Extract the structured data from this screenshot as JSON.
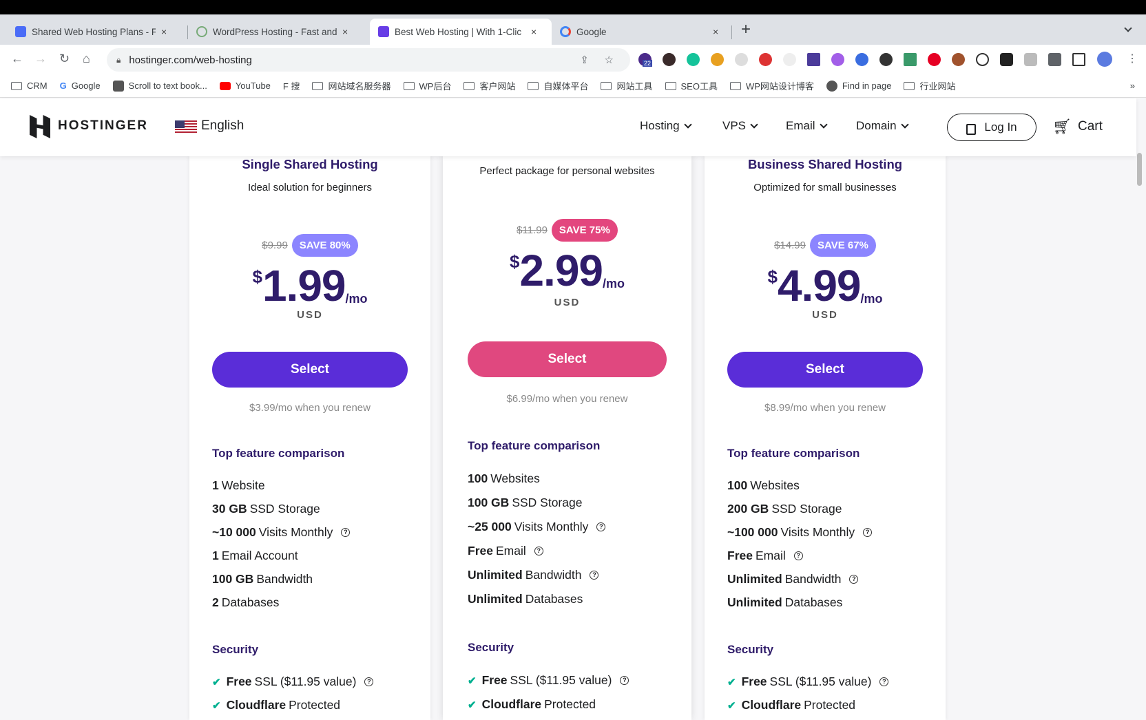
{
  "browser": {
    "tabs": [
      {
        "title": "Shared Web Hosting Plans - Fa",
        "icon": "grid-icon"
      },
      {
        "title": "WordPress Hosting - Fast and",
        "icon": "wp-icon"
      },
      {
        "title": "Best Web Hosting | With 1-Clic",
        "icon": "hostinger-icon",
        "active": true
      },
      {
        "title": "Google",
        "icon": "google-icon"
      }
    ],
    "close": "×",
    "new_tab": "+",
    "url": "hostinger.com/web-hosting",
    "ext_badge": "22",
    "bookmarks": [
      "CRM",
      "Google",
      "Scroll to text book...",
      "YouTube",
      "F 搜",
      "网站域名服务器",
      "WP后台",
      "客户网站",
      "自媒体平台",
      "网站工具",
      "SEO工具",
      "WP网站设计博客",
      "Find in page",
      "行业网站"
    ],
    "more": "»"
  },
  "header": {
    "logo": "HOSTINGER",
    "language": "English",
    "menu": [
      "Hosting",
      "VPS",
      "Email",
      "Domain"
    ],
    "login": "Log In",
    "cart": "Cart"
  },
  "colors": {
    "brand": "#673de6",
    "pink": "#e3467e",
    "badge_purple": "#8c85ff",
    "text": "#2f1c6a"
  },
  "plans": [
    {
      "title": "Single Shared Hosting",
      "subtitle": "Ideal solution for beginners",
      "old_price": "$9.99",
      "save": "SAVE 80%",
      "currency": "$",
      "price": "1.99",
      "per": "/mo",
      "usd": "USD",
      "select": "Select",
      "renew": "$3.99/mo when you renew",
      "features_title": "Top feature comparison",
      "features": [
        {
          "b": "1",
          "t": " Website"
        },
        {
          "b": "30 GB",
          "t": " SSD Storage"
        },
        {
          "b": "~10 000",
          "t": " Visits Monthly",
          "help": true
        },
        {
          "b": "1",
          "t": " Email Account"
        },
        {
          "b": "100 GB",
          "t": " Bandwidth"
        },
        {
          "b": "2",
          "t": " Databases"
        }
      ],
      "security_title": "Security",
      "security": [
        {
          "b": "Free",
          "t": " SSL ($11.95 value)"
        },
        {
          "b": "Cloudflare",
          "t": " Protected"
        }
      ]
    },
    {
      "title": "",
      "subtitle": "Perfect package for personal websites",
      "old_price": "$11.99",
      "save": "SAVE 75%",
      "currency": "$",
      "price": "2.99",
      "per": "/mo",
      "usd": "USD",
      "select": "Select",
      "renew": "$6.99/mo when you renew",
      "features_title": "Top feature comparison",
      "features": [
        {
          "b": "100",
          "t": " Websites"
        },
        {
          "b": "100 GB",
          "t": " SSD Storage"
        },
        {
          "b": "~25 000",
          "t": " Visits Monthly"
        },
        {
          "b": "Free",
          "t": " Email"
        },
        {
          "b": "Unlimited",
          "t": " Bandwidth"
        },
        {
          "b": "Unlimited",
          "t": " Databases"
        }
      ],
      "security_title": "Security",
      "security": [
        {
          "b": "Free",
          "t": " SSL ($11.95 value)"
        },
        {
          "b": "Cloudflare",
          "t": " Protected"
        }
      ]
    },
    {
      "title": "Business Shared Hosting",
      "subtitle": "Optimized for small businesses",
      "old_price": "$14.99",
      "save": "SAVE 67%",
      "currency": "$",
      "price": "4.99",
      "per": "/mo",
      "usd": "USD",
      "select": "Select",
      "renew": "$8.99/mo when you renew",
      "features_title": "Top feature comparison",
      "features": [
        {
          "b": "100",
          "t": " Websites"
        },
        {
          "b": "200 GB",
          "t": " SSD Storage"
        },
        {
          "b": "~100 000",
          "t": " Visits Monthly"
        },
        {
          "b": "Free",
          "t": " Email"
        },
        {
          "b": "Unlimited",
          "t": " Bandwidth"
        },
        {
          "b": "Unlimited",
          "t": " Databases"
        }
      ],
      "security_title": "Security",
      "security": [
        {
          "b": "Free",
          "t": " SSL ($11.95 value)"
        },
        {
          "b": "Cloudflare",
          "t": " Protected"
        }
      ]
    }
  ]
}
